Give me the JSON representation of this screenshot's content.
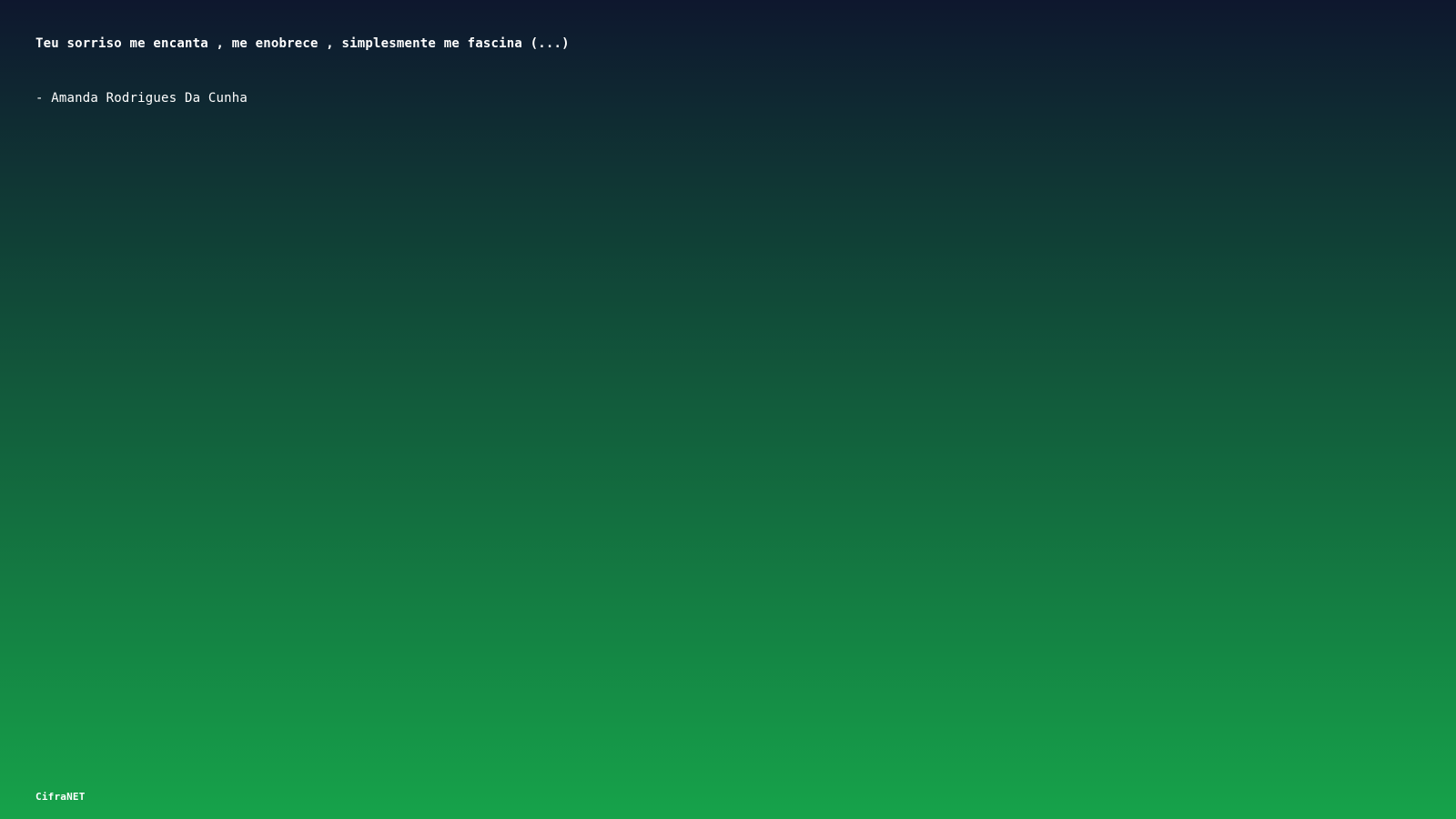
{
  "quote": {
    "text": "Teu sorriso me encanta , me enobrece , simplesmente me fascina (...)",
    "author": "- Amanda Rodrigues Da Cunha"
  },
  "brand": {
    "name": "CifraNET"
  },
  "colors": {
    "gradient_top": "#0e172e",
    "gradient_bottom": "#16a34a",
    "text": "#ffffff"
  }
}
